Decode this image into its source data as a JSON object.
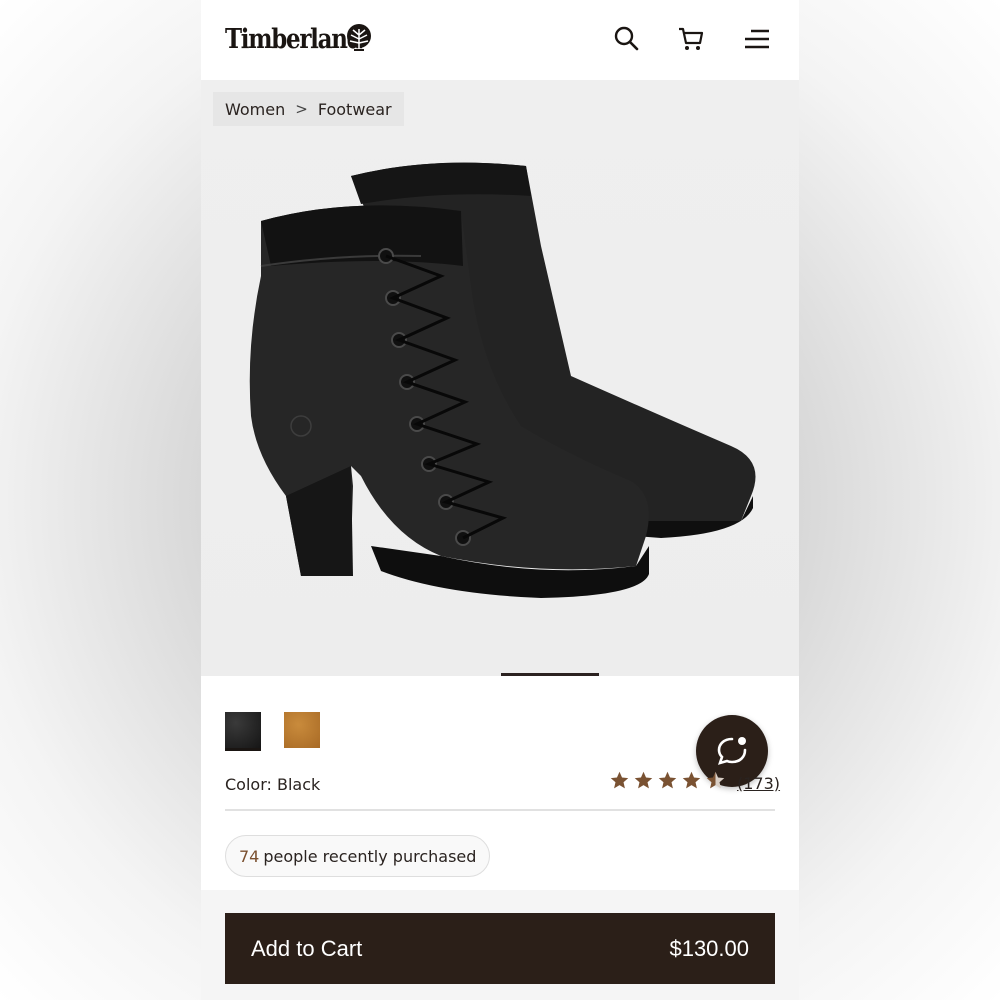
{
  "header": {
    "brand": "Timberland",
    "icons": [
      "search-icon",
      "cart-icon",
      "menu-icon"
    ]
  },
  "breadcrumb": {
    "items": [
      "Women",
      "Footwear"
    ],
    "separator": ">"
  },
  "product": {
    "image": "black-heeled-lace-up-boots",
    "carousel_active_index": 0
  },
  "options": {
    "swatches": [
      {
        "name": "Black",
        "color": "#1f1f1f",
        "selected": true
      },
      {
        "name": "Wheat",
        "color": "#b87a30",
        "selected": false
      }
    ],
    "color_label": "Color: Black"
  },
  "rating": {
    "stars": 4.5,
    "max": 5,
    "reviews": "(173)",
    "star_color": "#7a5232"
  },
  "social_proof": {
    "count": "74",
    "text": "people recently purchased"
  },
  "cart": {
    "label": "Add to Cart",
    "price": "$130.00"
  },
  "colors": {
    "brand_dark": "#2b1f18",
    "accent_brown": "#7a4f2e"
  }
}
